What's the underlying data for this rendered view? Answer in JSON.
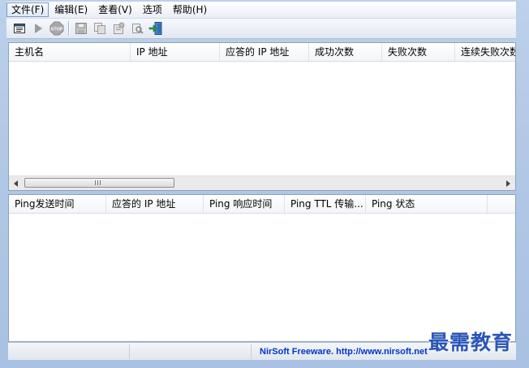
{
  "menu": {
    "items": [
      {
        "label": "文件(F)",
        "active": true
      },
      {
        "label": "编辑(E)"
      },
      {
        "label": "查看(V)"
      },
      {
        "label": "选项"
      },
      {
        "label": "帮助(H)"
      }
    ]
  },
  "toolbar": {
    "icons": [
      "properties-icon",
      "play-icon",
      "stop-icon",
      "save-icon",
      "copy-icon",
      "html-report-icon",
      "find-icon",
      "exit-icon"
    ]
  },
  "top_table": {
    "columns": [
      "主机名",
      "IP 地址",
      "应答的 IP 地址",
      "成功次数",
      "失败次数",
      "连续失败次数"
    ],
    "rows": []
  },
  "bottom_table": {
    "columns": [
      "Ping发送时间",
      "应答的 IP 地址",
      "Ping 响应时间",
      "Ping TTL 传输...",
      "Ping 状态"
    ],
    "rows": []
  },
  "scrollbar": {
    "grip": "III"
  },
  "statusbar": {
    "link": "NirSoft Freeware.  http://www.nirsoft.net"
  },
  "watermark": "最需教育",
  "colors": {
    "frame": "#b2c8e6",
    "link": "#0033cc",
    "watermark": "#2b56b8"
  }
}
